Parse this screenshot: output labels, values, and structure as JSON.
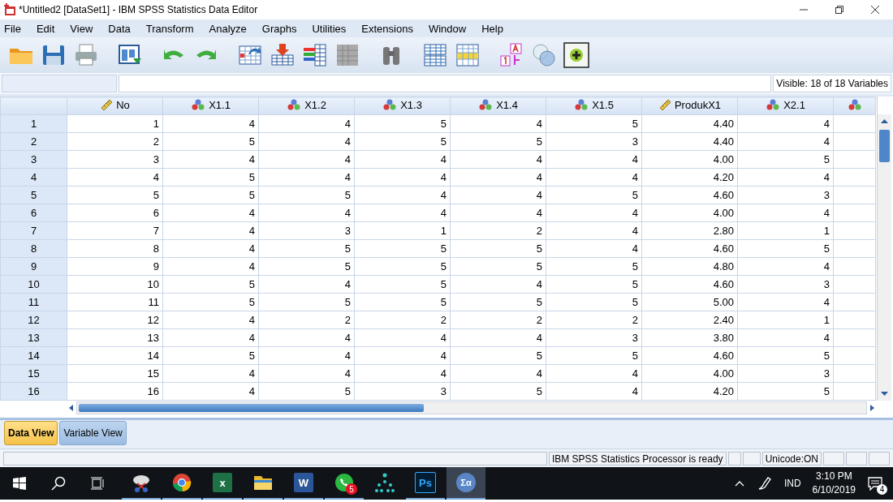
{
  "window": {
    "title": "*Untitled2 [DataSet1] - IBM SPSS Statistics Data Editor"
  },
  "menu": [
    "File",
    "Edit",
    "View",
    "Data",
    "Transform",
    "Analyze",
    "Graphs",
    "Utilities",
    "Extensions",
    "Window",
    "Help"
  ],
  "cell_editor": {
    "visible_info": "Visible: 18 of 18 Variables"
  },
  "table": {
    "columns": [
      {
        "label": "No",
        "kind": "scale"
      },
      {
        "label": "X1.1",
        "kind": "nominal"
      },
      {
        "label": "X1.2",
        "kind": "nominal"
      },
      {
        "label": "X1.3",
        "kind": "nominal"
      },
      {
        "label": "X1.4",
        "kind": "nominal"
      },
      {
        "label": "X1.5",
        "kind": "nominal"
      },
      {
        "label": "ProdukX1",
        "kind": "scale"
      },
      {
        "label": "X2.1",
        "kind": "nominal"
      },
      {
        "kind": "nominal"
      }
    ],
    "rows": [
      {
        "number": "1",
        "cells": [
          "1",
          "4",
          "4",
          "5",
          "4",
          "5",
          "4.40",
          "4"
        ]
      },
      {
        "number": "2",
        "cells": [
          "2",
          "5",
          "4",
          "5",
          "5",
          "3",
          "4.40",
          "4"
        ]
      },
      {
        "number": "3",
        "cells": [
          "3",
          "4",
          "4",
          "4",
          "4",
          "4",
          "4.00",
          "5"
        ]
      },
      {
        "number": "4",
        "cells": [
          "4",
          "5",
          "4",
          "4",
          "4",
          "4",
          "4.20",
          "4"
        ]
      },
      {
        "number": "5",
        "cells": [
          "5",
          "5",
          "5",
          "4",
          "4",
          "5",
          "4.60",
          "3"
        ]
      },
      {
        "number": "6",
        "cells": [
          "6",
          "4",
          "4",
          "4",
          "4",
          "4",
          "4.00",
          "4"
        ]
      },
      {
        "number": "7",
        "cells": [
          "7",
          "4",
          "3",
          "1",
          "2",
          "4",
          "2.80",
          "1"
        ]
      },
      {
        "number": "8",
        "cells": [
          "8",
          "4",
          "5",
          "5",
          "5",
          "4",
          "4.60",
          "5"
        ]
      },
      {
        "number": "9",
        "cells": [
          "9",
          "4",
          "5",
          "5",
          "5",
          "5",
          "4.80",
          "4"
        ]
      },
      {
        "number": "10",
        "cells": [
          "10",
          "5",
          "4",
          "5",
          "4",
          "5",
          "4.60",
          "3"
        ]
      },
      {
        "number": "11",
        "cells": [
          "11",
          "5",
          "5",
          "5",
          "5",
          "5",
          "5.00",
          "4"
        ]
      },
      {
        "number": "12",
        "cells": [
          "12",
          "4",
          "2",
          "2",
          "2",
          "2",
          "2.40",
          "1"
        ]
      },
      {
        "number": "13",
        "cells": [
          "13",
          "4",
          "4",
          "4",
          "4",
          "3",
          "3.80",
          "4"
        ]
      },
      {
        "number": "14",
        "cells": [
          "14",
          "5",
          "4",
          "4",
          "5",
          "5",
          "4.60",
          "5"
        ]
      },
      {
        "number": "15",
        "cells": [
          "15",
          "4",
          "4",
          "4",
          "4",
          "4",
          "4.00",
          "3"
        ]
      },
      {
        "number": "16",
        "cells": [
          "16",
          "4",
          "5",
          "3",
          "5",
          "4",
          "4.20",
          "5"
        ]
      }
    ]
  },
  "tabs": [
    {
      "label": "Data View",
      "selected": true
    },
    {
      "label": "Variable View",
      "selected": false
    }
  ],
  "status_bar": {
    "message": "IBM SPSS Statistics Processor is ready",
    "encoding": "Unicode:ON"
  },
  "taskbar": {
    "apps": [
      {
        "kind": "snip",
        "running": true,
        "active": false
      },
      {
        "kind": "browser",
        "running": true,
        "active": false
      },
      {
        "kind": "sheet",
        "glyph": "x",
        "running": true,
        "active": false
      },
      {
        "kind": "folder",
        "running": true,
        "active": false
      },
      {
        "kind": "doc",
        "glyph": "W",
        "running": true,
        "active": false
      },
      {
        "kind": "chat",
        "badge": "5",
        "running": true,
        "active": false
      },
      {
        "kind": "network",
        "running": false,
        "active": false
      },
      {
        "kind": "photo",
        "glyph": "Ps",
        "running": true,
        "active": false
      },
      {
        "kind": "stats",
        "glyph": "Σα",
        "running": true,
        "active": true
      }
    ],
    "language": "IND",
    "time": "3:10 PM",
    "date": "6/10/2019",
    "notifications": "4"
  }
}
